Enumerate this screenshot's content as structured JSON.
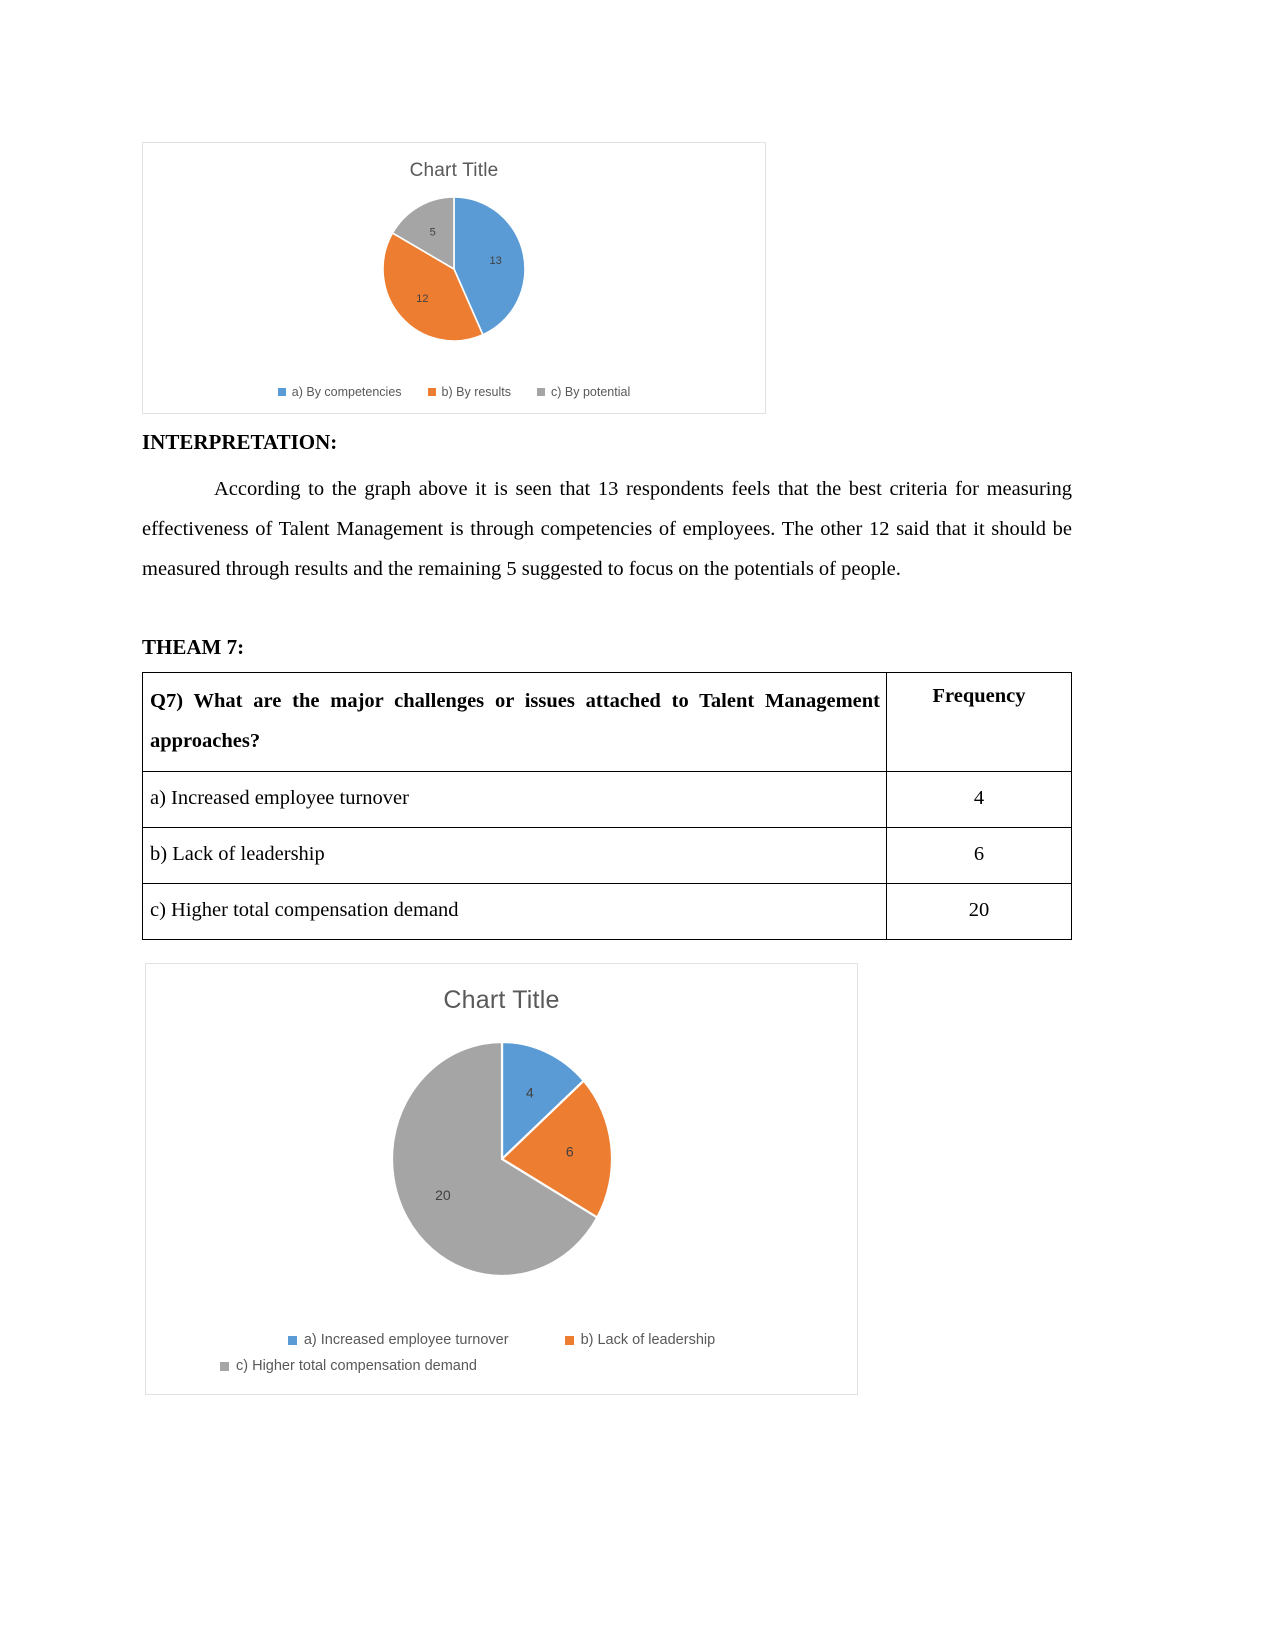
{
  "document": {
    "interpretation_heading": "INTERPRETATION:",
    "interpretation_paragraph": "According to the graph above it is seen that 13 respondents feels that the best criteria for measuring effectiveness of Talent Management is through competencies of employees. The other 12 said that it should be measured through results and the remaining 5 suggested to focus on the potentials of people.",
    "theam_heading": "THEAM 7:"
  },
  "table": {
    "question_header": "Q7) What are the major challenges or issues attached to Talent Management approaches?",
    "frequency_header": "Frequency",
    "rows": [
      {
        "option": "a) Increased employee turnover",
        "frequency": "4"
      },
      {
        "option": "b) Lack of leadership",
        "frequency": "6"
      },
      {
        "option": "c) Higher total compensation demand",
        "frequency": "20"
      }
    ]
  },
  "chart_data": [
    {
      "id": "chart-1",
      "type": "pie",
      "title": "Chart Title",
      "xlabel": "",
      "ylabel": "",
      "legend_position": "bottom",
      "total": 30,
      "categories": [
        "a) By competencies",
        "b) By results",
        "c) By potential"
      ],
      "values": [
        13,
        12,
        5
      ],
      "colors": [
        "#5B9BD5",
        "#ED7D31",
        "#A5A5A5"
      ],
      "labels": [
        "13",
        "12",
        "5"
      ],
      "start_angle_deg": 0
    },
    {
      "id": "chart-2",
      "type": "pie",
      "title": "Chart Title",
      "xlabel": "",
      "ylabel": "",
      "legend_position": "bottom",
      "total": 30,
      "categories": [
        "a) Increased employee turnover",
        "b) Lack of leadership",
        "c) Higher total compensation demand"
      ],
      "values": [
        4,
        6,
        20
      ],
      "colors": [
        "#5B9BD5",
        "#ED7D31",
        "#A5A5A5"
      ],
      "labels": [
        "4",
        "6",
        "20"
      ],
      "start_angle_deg": 0
    }
  ]
}
